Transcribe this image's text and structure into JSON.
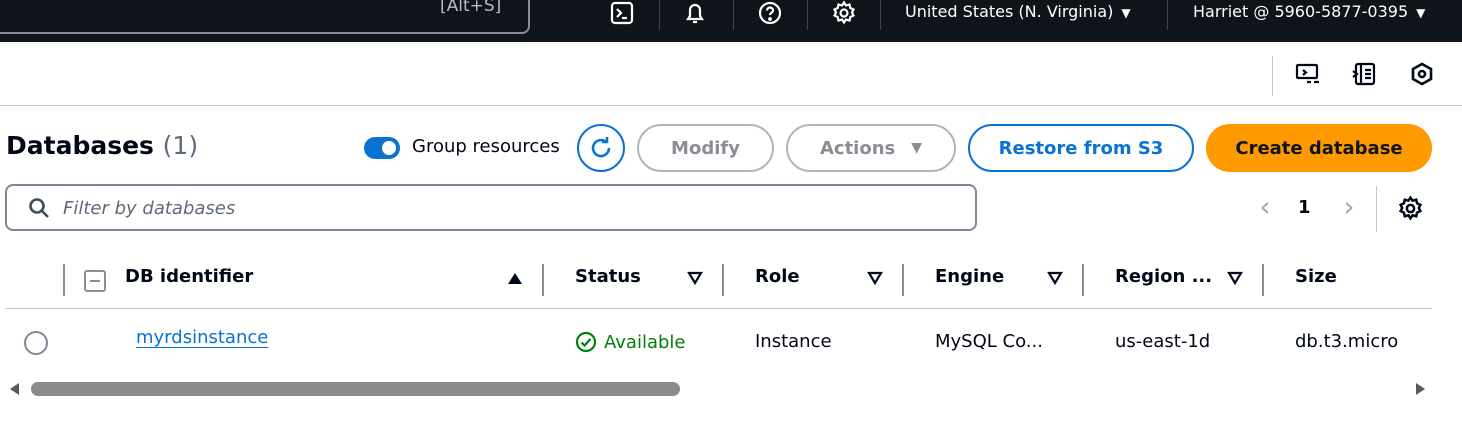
{
  "topnav": {
    "search_shortcut": "[Alt+S]",
    "icons": [
      "cloudshell-icon",
      "bell-icon",
      "help-icon",
      "gear-icon"
    ],
    "region": "United States (N. Virginia)",
    "account": "Harriet @ 5960-5877-0395"
  },
  "subbar": {
    "icons": [
      "feedback-monitor-icon",
      "side-panel-icon",
      "hexagon-icon"
    ]
  },
  "header": {
    "title": "Databases",
    "count": "(1)",
    "group_resources_label": "Group resources",
    "group_resources_on": true,
    "modify_label": "Modify",
    "actions_label": "Actions",
    "restore_label": "Restore from S3",
    "create_label": "Create database"
  },
  "filter": {
    "placeholder": "Filter by databases",
    "value": ""
  },
  "pagination": {
    "current_page": "1"
  },
  "table": {
    "columns": [
      "DB identifier",
      "Status",
      "Role",
      "Engine",
      "Region ...",
      "Size"
    ],
    "rows": [
      {
        "db_identifier": "myrdsinstance",
        "status": "Available",
        "role": "Instance",
        "engine": "MySQL Co...",
        "region": "us-east-1d",
        "size": "db.t3.micro"
      }
    ]
  },
  "scrollbar": {
    "thumb_fraction": 0.46
  },
  "colors": {
    "nav_bg": "#0f141a",
    "link_blue": "#0972d3",
    "primary_orange": "#ff9900",
    "success_green": "#037f0c"
  }
}
